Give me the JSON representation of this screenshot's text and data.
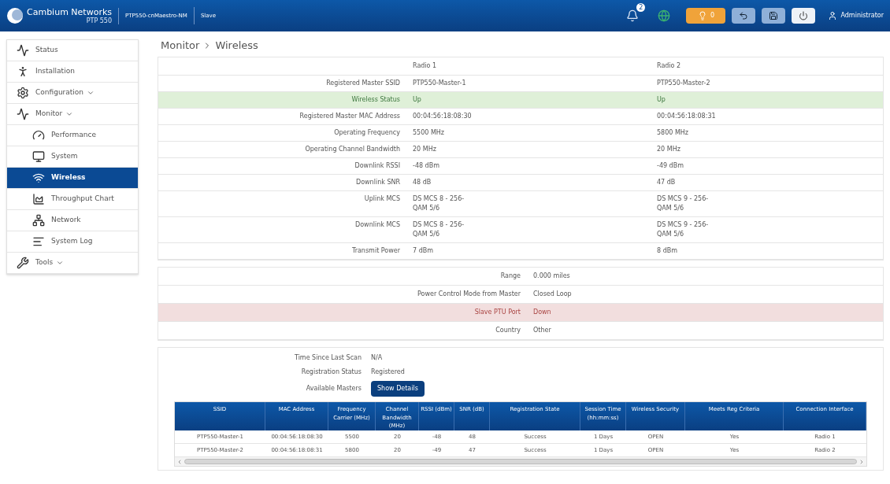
{
  "header": {
    "brand": "Cambium Networks",
    "model": "PTP 550",
    "device_name": "PTP550-cnMaestro-NM",
    "mode": "Slave",
    "notification_count": "2",
    "alarm_count": "0",
    "user": "Administrator"
  },
  "sidebar": {
    "items": [
      {
        "label": "Status",
        "selected": false,
        "submenu": false
      },
      {
        "label": "Installation",
        "selected": false,
        "submenu": false
      },
      {
        "label": "Configuration",
        "selected": false,
        "submenu": true
      },
      {
        "label": "Monitor",
        "selected": false,
        "submenu": true,
        "children": [
          {
            "label": "Performance",
            "selected": false
          },
          {
            "label": "System",
            "selected": false
          },
          {
            "label": "Wireless",
            "selected": true
          },
          {
            "label": "Throughput Chart",
            "selected": false
          },
          {
            "label": "Network",
            "selected": false
          },
          {
            "label": "System Log",
            "selected": false
          }
        ]
      },
      {
        "label": "Tools",
        "selected": false,
        "submenu": true
      }
    ]
  },
  "breadcrumb": [
    "Monitor",
    "Wireless"
  ],
  "radio_table": {
    "columns": [
      "Radio 1",
      "Radio 2"
    ],
    "rows": [
      {
        "label": "Registered Master SSID",
        "values": [
          "PTP550-Master-1",
          "PTP550-Master-2"
        ],
        "kind": "plain"
      },
      {
        "label": "Wireless Status",
        "values": [
          "Up",
          "Up"
        ],
        "kind": "success"
      },
      {
        "label": "Registered Master MAC Address",
        "values": [
          "00:04:56:18:08:30",
          "00:04:56:18:08:31"
        ],
        "kind": "plain"
      },
      {
        "label": "Operating Frequency",
        "values": [
          "5500 MHz",
          "5800 MHz"
        ],
        "kind": "plain"
      },
      {
        "label": "Operating Channel Bandwidth",
        "values": [
          "20 MHz",
          "20 MHz"
        ],
        "kind": "plain"
      },
      {
        "label": "Downlink RSSI",
        "values": [
          "-48 dBm",
          "-49 dBm"
        ],
        "kind": "plain"
      },
      {
        "label": "Downlink SNR",
        "values": [
          "48 dB",
          "47 dB"
        ],
        "kind": "plain"
      },
      {
        "label": "Uplink MCS",
        "values": [
          "DS MCS 8 - 256-QAM 5/6",
          "DS MCS 9 - 256-QAM 5/6"
        ],
        "kind": "plain"
      },
      {
        "label": "Downlink MCS",
        "values": [
          "DS MCS 8 - 256-QAM 5/6",
          "DS MCS 9 - 256-QAM 5/6"
        ],
        "kind": "plain"
      },
      {
        "label": "Transmit Power",
        "values": [
          "7 dBm",
          "8 dBm"
        ],
        "kind": "plain"
      }
    ]
  },
  "general_table": {
    "rows": [
      {
        "label": "Range",
        "value": "0.000 miles",
        "kind": "plain"
      },
      {
        "label": "Power Control Mode from Master",
        "value": "Closed Loop",
        "kind": "plain"
      },
      {
        "label": "Slave PTU Port",
        "value": "Down",
        "kind": "danger"
      },
      {
        "label": "Country",
        "value": "Other",
        "kind": "plain"
      }
    ]
  },
  "scan": {
    "fields": [
      {
        "label": "Time Since Last Scan",
        "value": "N/A"
      },
      {
        "label": "Registration Status",
        "value": "Registered"
      }
    ],
    "available_label": "Available Masters",
    "details_button": "Show Details"
  },
  "masters_table": {
    "columns": [
      "SSID",
      "MAC Address",
      "Frequency Carrier (MHz)",
      "Channel Bandwidth (MHz)",
      "RSSI (dBm)",
      "SNR (dB)",
      "Registration State",
      "Session Time (hh:mm:ss)",
      "Wireless Security",
      "Meets Reg Criteria",
      "Connection Interface"
    ],
    "rows": [
      [
        "PTP550-Master-1",
        "00:04:56:18:08:30",
        "5500",
        "20",
        "-48",
        "48",
        "Success",
        "1 Days",
        "OPEN",
        "Yes",
        "Radio 1"
      ],
      [
        "PTP550-Master-2",
        "00:04:56:18:08:31",
        "5800",
        "20",
        "-49",
        "47",
        "Success",
        "1 Days",
        "OPEN",
        "Yes",
        "Radio 2"
      ]
    ]
  }
}
